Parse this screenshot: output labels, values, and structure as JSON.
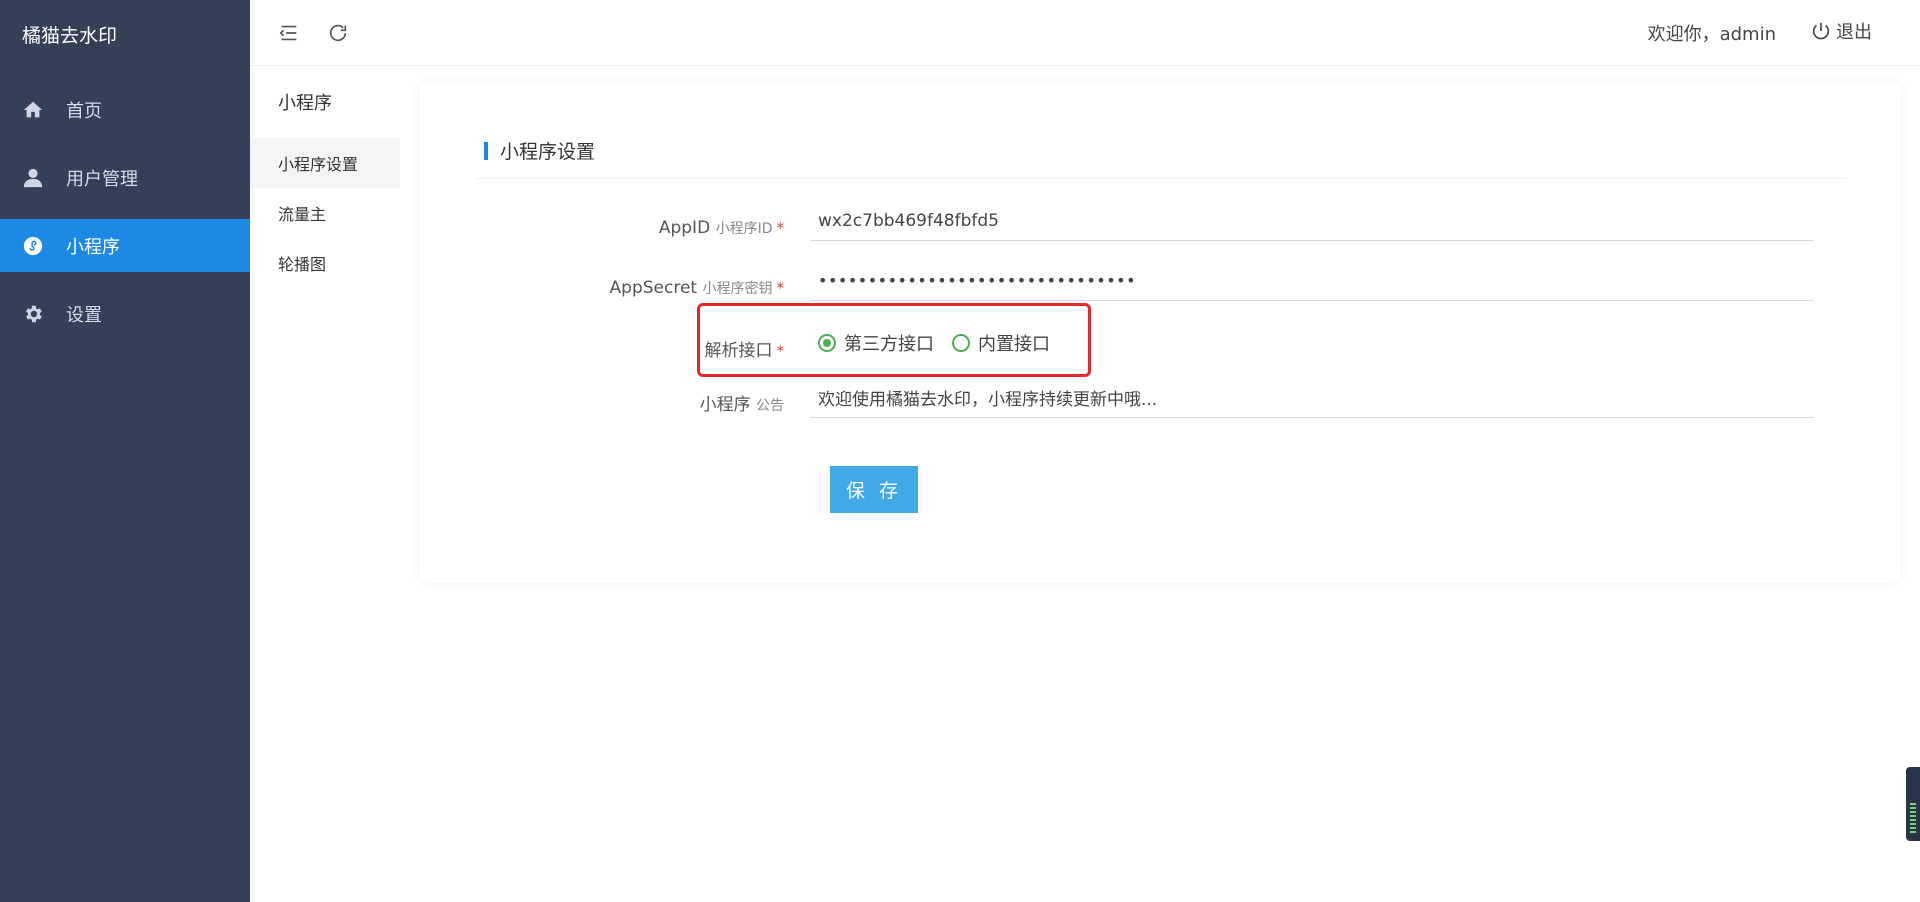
{
  "app": {
    "brand": "橘猫去水印"
  },
  "sidebar": {
    "items": [
      {
        "label": "首页",
        "icon": "home-icon"
      },
      {
        "label": "用户管理",
        "icon": "user-icon"
      },
      {
        "label": "小程序",
        "icon": "miniapp-icon",
        "active": true
      },
      {
        "label": "设置",
        "icon": "gear-icon"
      }
    ]
  },
  "header": {
    "welcome": "欢迎你，admin",
    "logout_label": "退出"
  },
  "submenu": {
    "title": "小程序",
    "items": [
      {
        "label": "小程序设置",
        "active": true
      },
      {
        "label": "流量主"
      },
      {
        "label": "轮播图"
      }
    ]
  },
  "card": {
    "title": "小程序设置"
  },
  "form": {
    "appid": {
      "label": "AppID",
      "sub": "小程序ID",
      "required": "*",
      "value": "wx2c7bb469f48fbfd5"
    },
    "appsecret": {
      "label": "AppSecret",
      "sub": "小程序密钥",
      "required": "*",
      "value": "••••••••••••••••••••••••••••••••"
    },
    "parse_api": {
      "label": "解析接口",
      "required": "*",
      "options": [
        {
          "label": "第三方接口",
          "checked": true
        },
        {
          "label": "内置接口",
          "checked": false
        }
      ]
    },
    "notice": {
      "label": "小程序",
      "sub": "公告",
      "value": "欢迎使用橘猫去水印，小程序持续更新中哦..."
    },
    "save_label": "保 存"
  },
  "colors": {
    "sidebar_bg": "#344058",
    "accent": "#1e88e5",
    "save_button": "#42a9e8",
    "radio": "#4caf50",
    "highlight": "#e22a2a"
  }
}
